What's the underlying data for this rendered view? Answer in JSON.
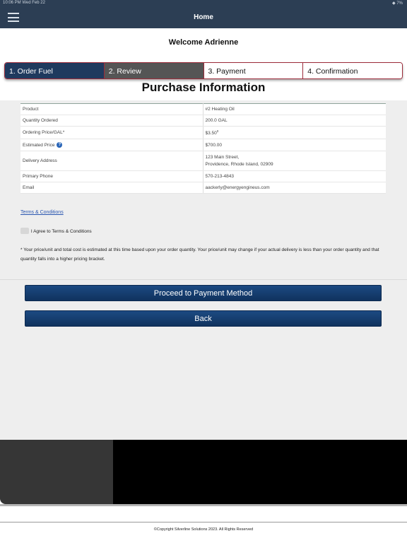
{
  "status_bar": {
    "time": "10:06 PM   Wed Feb 22",
    "indicators": "◆  7%"
  },
  "header": {
    "title": "Home",
    "menu_icon": "hamburger-menu-icon"
  },
  "welcome": "Welcome Adrienne",
  "steps": [
    {
      "label": "1. Order Fuel",
      "state": "active"
    },
    {
      "label": "2. Review",
      "state": "current"
    },
    {
      "label": "3. Payment",
      "state": "upcoming"
    },
    {
      "label": "4. Confirmation",
      "state": "upcoming"
    }
  ],
  "page_title": "Purchase Information",
  "purchase_info": {
    "product": {
      "label": "Product",
      "value": "#2 Heating Oil"
    },
    "quantity": {
      "label": "Quantity Ordered",
      "value": "200.0 GAL"
    },
    "price": {
      "label": "Ordering Price/GAL*",
      "value": "$3.50",
      "sup": "0"
    },
    "estimated": {
      "label": "Estimated Price",
      "value": "$700.00",
      "icon": "help-icon"
    },
    "address": {
      "label": "Delivery Address",
      "line1": "123 Main Street,",
      "line2": "Providence, Rhode Island, 02909"
    },
    "phone": {
      "label": "Primary Phone",
      "value": "570-213-4843"
    },
    "email": {
      "label": "Email",
      "value": "aackerly@energyengineus.com"
    }
  },
  "terms_link": "Terms & Conditions",
  "agree_label": "I Agree to Terms & Conditions",
  "note": "* Your price/unit and total cost is estimated at this time based upon your order quantity. Your price/unit may change if your actual delivery is less than your order quantity and that quantity falls into a higher pricing bracket.",
  "buttons": {
    "proceed": "Proceed to Payment Method",
    "back": "Back"
  },
  "footer": "©Copyright Silverline Solutions 2023. All Rights Reserved",
  "colors": {
    "header_bg": "#2c3e54",
    "step_active": "#1f3a5e",
    "step_current": "#555555",
    "step_border": "#9c2b3a",
    "button_bg": "#123a6a",
    "link": "#2a56b0"
  }
}
